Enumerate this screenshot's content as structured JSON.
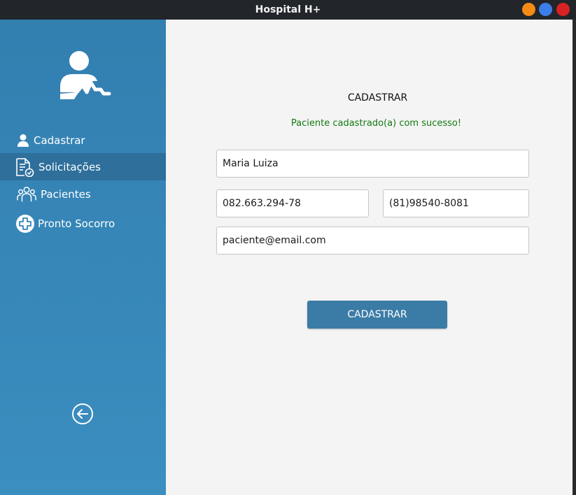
{
  "window": {
    "title": "Hospital H+"
  },
  "colors": {
    "sidebar": "#3584b6",
    "sidebar_active": "#2e6f9b",
    "button": "#3b7ca7",
    "success": "#127a12",
    "content_bg": "#f4f4f4"
  },
  "sidebar": {
    "logo_icon": "doctor-heartbeat-icon",
    "items": [
      {
        "label": "Cadastrar",
        "icon": "user-icon"
      },
      {
        "label": "Solicitações",
        "icon": "document-check-icon"
      },
      {
        "label": "Pacientes",
        "icon": "users-group-icon"
      },
      {
        "label": "Pronto Socorro",
        "icon": "medical-cross-icon"
      }
    ],
    "active_item": "Solicitações",
    "back_icon": "arrow-left-circle-icon"
  },
  "form": {
    "heading": "CADASTRAR",
    "message": "Paciente cadastrado(a) com sucesso!",
    "name_value": "Maria Luiza",
    "cpf_value": "082.663.294-78",
    "phone_value": "(81)98540-8081",
    "email_value": "paciente@email.com",
    "submit_label": "CADASTRAR"
  }
}
